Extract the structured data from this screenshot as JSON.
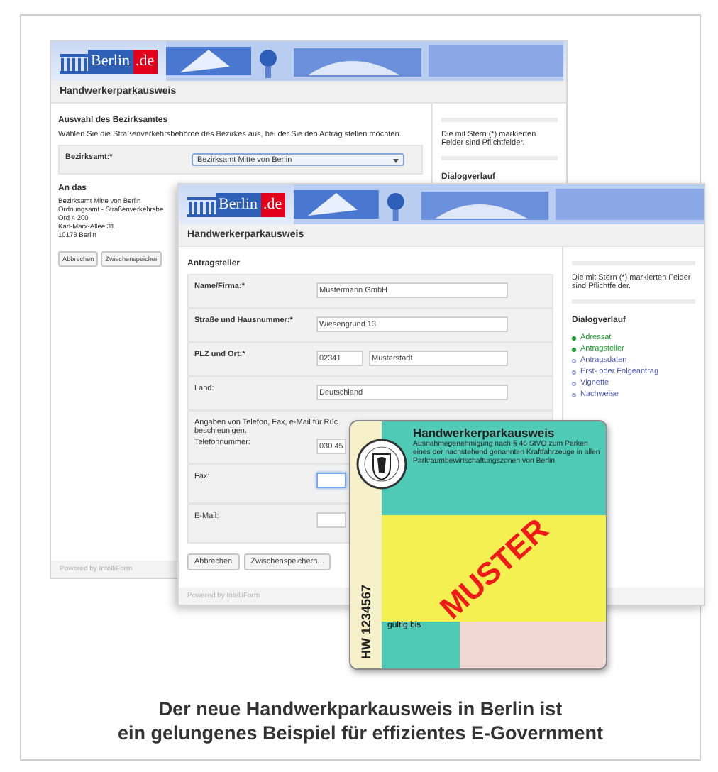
{
  "back_window": {
    "banner": {
      "logo": "Berlin",
      "logo_suffix": ".de"
    },
    "title": "Handwerkerparkausweis",
    "section_heading": "Auswahl des Bezirksamtes",
    "instruction": "Wählen Sie die Straßenverkehrsbehörde des Bezirkes aus, bei der Sie den Antrag stellen möchten.",
    "select": {
      "label": "Bezirksamt:*",
      "value": "Bezirksamt Mitte von Berlin"
    },
    "address_heading": "An das",
    "address_lines": [
      "Bezirksamt Mitte von Berlin",
      "Ordnungsamt - Straßenverkehrsbe",
      "Ord 4 200",
      "Karl-Marx-Allee 31",
      "10178 Berlin"
    ],
    "buttons": [
      "Abbrechen",
      "Zwischenspeicher"
    ],
    "footer": "Powered by IntelliForm",
    "sidebar": {
      "note": "Die mit Stern (*) markierten Felder sind Pflichtfelder.",
      "heading": "Dialogverlauf"
    }
  },
  "front_window": {
    "banner": {
      "logo": "Berlin",
      "logo_suffix": ".de"
    },
    "title": "Handwerkerparkausweis",
    "section_heading": "Antragsteller",
    "fields": [
      {
        "kind": "text",
        "label": "Name/Firma:*",
        "required": true,
        "values": [
          "Mustermann GmbH"
        ]
      },
      {
        "kind": "text",
        "label": "Straße und Hausnummer:*",
        "required": true,
        "values": [
          "Wiesengrund 13"
        ]
      },
      {
        "kind": "pair",
        "label": "PLZ und Ort:*",
        "required": true,
        "values": [
          "02341",
          "Musterstadt"
        ]
      },
      {
        "kind": "text",
        "label": "Land:",
        "required": false,
        "values": [
          "Deutschland"
        ]
      }
    ],
    "contact_note": [
      "Angaben von Telefon, Fax, e-Mail für Rüc",
      "beschleunigen."
    ],
    "contact_fields": [
      {
        "label": "Telefonnummer:",
        "value": "030 45",
        "focused": false
      },
      {
        "label": "Fax:",
        "focused": true
      },
      {
        "label": "E-Mail:",
        "focused": false
      }
    ],
    "buttons": [
      "Abbrechen",
      "Zwischenspeichern..."
    ],
    "footer": "Powered by IntelliForm",
    "sidebar": {
      "note": "Die mit Stern (*) markierten Felder sind Pflichtfelder.",
      "heading": "Dialogverlauf",
      "steps": [
        {
          "label": "Adressat",
          "done": true
        },
        {
          "label": "Antragsteller",
          "done": true
        },
        {
          "label": "Antragsdaten",
          "done": false
        },
        {
          "label": "Erst- oder Folgeantrag",
          "done": false
        },
        {
          "label": "Vignette",
          "done": false
        },
        {
          "label": "Nachweise",
          "done": false
        }
      ]
    }
  },
  "permit": {
    "title": "Handwerkerparkausweis",
    "text": "Ausnahmegenehmigung nach § 46 StVO zum Parken eines der nachstehend genannten Kraftfahrzeuge in allen Parkraumbewirtschaftungszonen von Berlin",
    "number": "HW 1234567",
    "stamp": "MUSTER",
    "valid_label": "gültig bis"
  },
  "caption": [
    "Der neue Handwerkparkausweis in Berlin ist",
    "ein gelungenes Beispiel für effizientes E-Government"
  ]
}
